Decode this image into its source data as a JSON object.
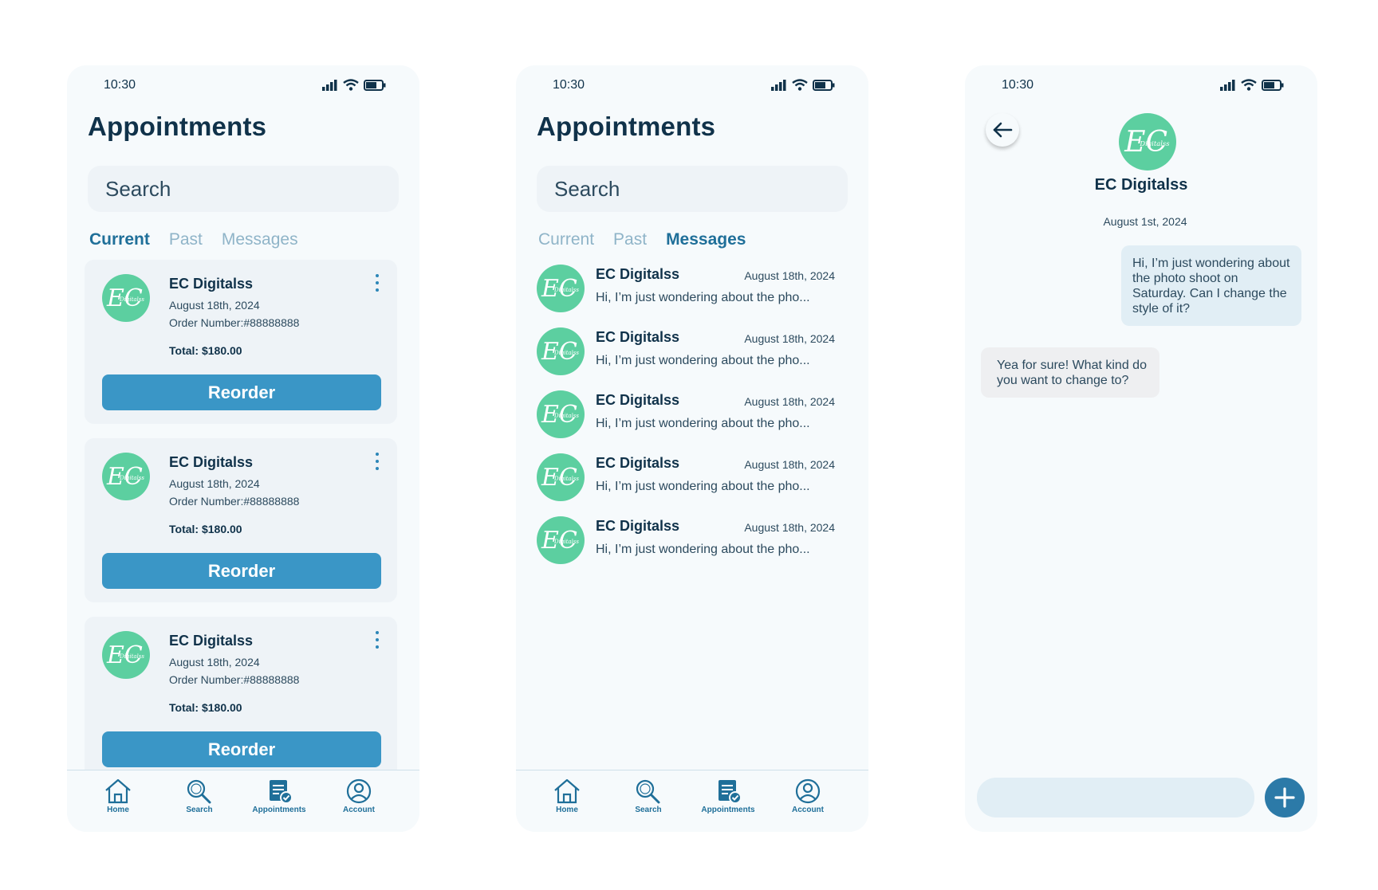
{
  "screens": [
    {
      "status_time": "10:30",
      "title": "Appointments",
      "search_placeholder": "Search",
      "tabs": [
        "Current",
        "Past",
        "Messages"
      ],
      "active_tab": "Current",
      "cards": [
        {
          "name": "EC Digitalss",
          "date": "August 18th, 2024",
          "order": "Order Number:#88888888",
          "total": "Total: $180.00",
          "button": "Reorder"
        },
        {
          "name": "EC Digitalss",
          "date": "August 18th, 2024",
          "order": "Order Number:#88888888",
          "total": "Total: $180.00",
          "button": "Reorder"
        },
        {
          "name": "EC Digitalss",
          "date": "August 18th, 2024",
          "order": "Order Number:#88888888",
          "total": "Total: $180.00",
          "button": "Reorder"
        }
      ],
      "nav": [
        "Home",
        "Search",
        "Appointments",
        "Account"
      ]
    },
    {
      "status_time": "10:30",
      "title": "Appointments",
      "search_placeholder": "Search",
      "tabs": [
        "Current",
        "Past",
        "Messages"
      ],
      "active_tab": "Messages",
      "messages": [
        {
          "name": "EC Digitalss",
          "date": "August 18th, 2024",
          "preview": "Hi, I’m just wondering about the pho..."
        },
        {
          "name": "EC Digitalss",
          "date": "August 18th, 2024",
          "preview": "Hi, I’m just wondering about the pho..."
        },
        {
          "name": "EC Digitalss",
          "date": "August 18th, 2024",
          "preview": "Hi, I’m just wondering about the pho..."
        },
        {
          "name": "EC Digitalss",
          "date": "August 18th, 2024",
          "preview": "Hi, I’m just wondering about the pho..."
        },
        {
          "name": "EC Digitalss",
          "date": "August 18th, 2024",
          "preview": "Hi, I’m just wondering about the pho..."
        }
      ],
      "nav": [
        "Home",
        "Search",
        "Appointments",
        "Account"
      ]
    },
    {
      "status_time": "10:30",
      "contact_name": "EC Digitalss",
      "date": "August 1st, 2024",
      "outgoing": "Hi, I’m just wondering about the photo shoot on Saturday. Can I change the style of it?",
      "incoming": "Yea for sure! What kind do you want to change to?"
    }
  ],
  "logo_text": "EC",
  "logo_subtext": "Digitalss",
  "icons": {
    "back": "arrow-left-icon",
    "send": "plus-icon",
    "home": "home-icon",
    "search": "search-icon",
    "appointments": "appointments-icon",
    "account": "account-icon",
    "menu": "more-vertical-icon"
  },
  "colors": {
    "accent": "#3a96c6",
    "active_tab": "#1f6f99",
    "logo_bg": "#5ccfa0",
    "text_dark": "#10324a",
    "send_button": "#2c7aa8"
  }
}
